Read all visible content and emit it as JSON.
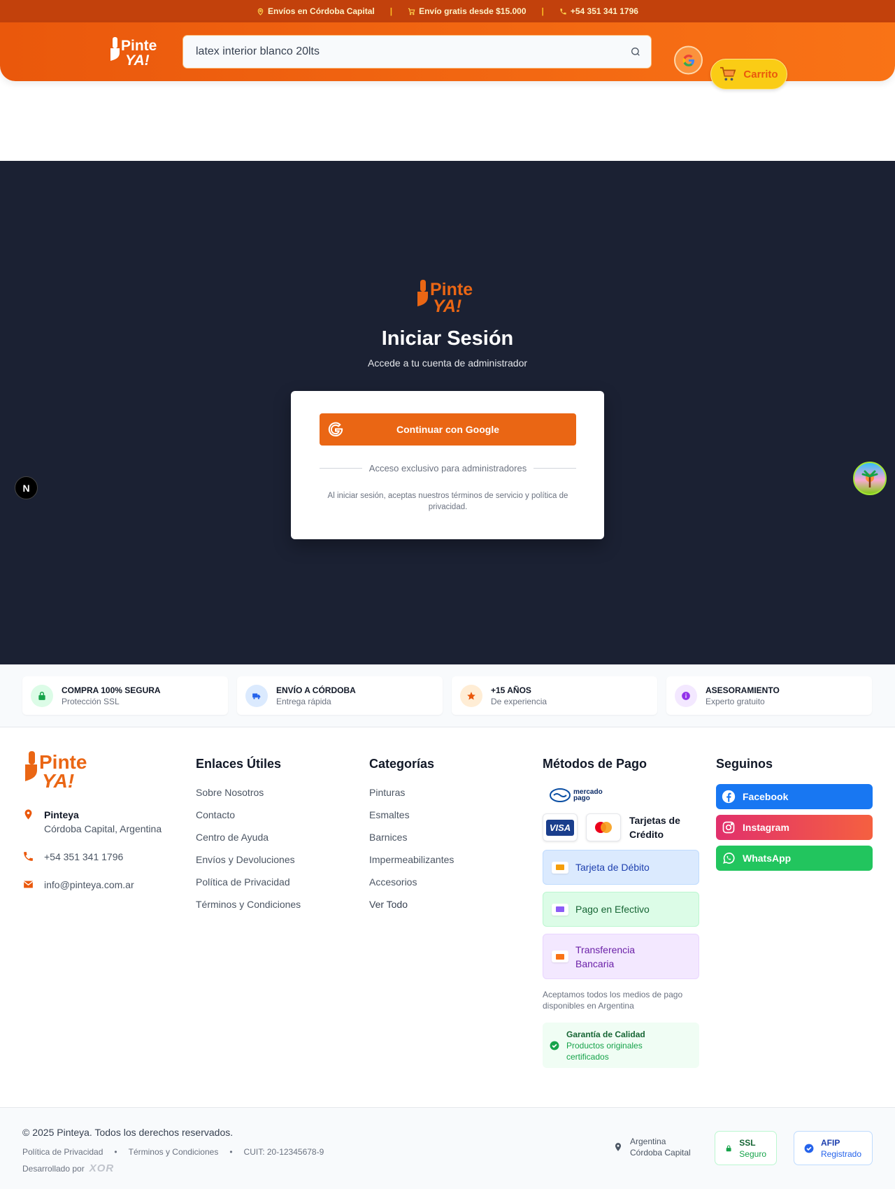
{
  "topbar": {
    "shipping": "Envíos en Córdoba Capital",
    "free_shipping": "Envío gratis desde $15.000",
    "phone": "+54 351 341 1796"
  },
  "brand": {
    "line1": "Pinte",
    "line2": "YA!"
  },
  "search": {
    "value": "latex interior blanco 20lts"
  },
  "header": {
    "cart_label": "Carrito"
  },
  "login": {
    "title": "Iniciar Sesión",
    "subtitle": "Accede a tu cuenta de administrador",
    "google_button": "Continuar con Google",
    "divider_text": "Acceso exclusivo para administradores",
    "legal": "Al iniciar sesión, aceptas nuestros términos de servicio y política de privacidad."
  },
  "dev_badge": "N",
  "features": [
    {
      "title": "COMPRA 100% SEGURA",
      "sub": "Protección SSL",
      "bg": "#dcfce7",
      "color": "#16a34a",
      "icon": "lock-icon"
    },
    {
      "title": "ENVÍO A CÓRDOBA",
      "sub": "Entrega rápida",
      "bg": "#dbeafe",
      "color": "#2563eb",
      "icon": "truck-icon"
    },
    {
      "title": "+15 AÑOS",
      "sub": "De experiencia",
      "bg": "#ffedd5",
      "color": "#ea580c",
      "icon": "star-icon"
    },
    {
      "title": "ASESORAMIENTO",
      "sub": "Experto gratuito",
      "bg": "#f3e8ff",
      "color": "#9333ea",
      "icon": "info-icon"
    }
  ],
  "footer": {
    "company": "Pinteya",
    "address": "Córdoba Capital, Argentina",
    "phone": "+54 351 341 1796",
    "email": "info@pinteya.com.ar",
    "links_title": "Enlaces Útiles",
    "links": [
      "Sobre Nosotros",
      "Contacto",
      "Centro de Ayuda",
      "Envíos y Devoluciones",
      "Política de Privacidad",
      "Términos y Condiciones"
    ],
    "categories_title": "Categorías",
    "categories": [
      "Pinturas",
      "Esmaltes",
      "Barnices",
      "Impermeabilizantes",
      "Accesorios",
      "Ver Todo"
    ],
    "payment_title": "Métodos de Pago",
    "mercadopago": "mercado pago",
    "visa": "VISA",
    "credit_cards": "Tarjetas de Crédito",
    "debit": "Tarjeta de Débito",
    "cash": "Pago en Efectivo",
    "transfer": "Transferencia Bancaria",
    "payment_note": "Aceptamos todos los medios de pago disponibles en Argentina",
    "guarantee_title": "Garantía de Calidad",
    "guarantee_sub": "Productos originales certificados",
    "social_title": "Seguinos",
    "social": [
      "Facebook",
      "Instagram",
      "WhatsApp"
    ]
  },
  "bottom": {
    "copyright": "© 2025 Pinteya. Todos los derechos reservados.",
    "privacy": "Política de Privacidad",
    "terms": "Términos y Condiciones",
    "cuit": "CUIT: 20-12345678-9",
    "dev_by": "Desarrollado por",
    "dev_logo": "XOR",
    "country": "Argentina",
    "city": "Córdoba Capital",
    "ssl_title": "SSL",
    "ssl_sub": "Seguro",
    "afip_title": "AFIP",
    "afip_sub": "Registrado"
  },
  "colors": {
    "brand_orange": "#ea580c",
    "topbar": "#c2410c",
    "login_bg": "#1b2133",
    "cart_yellow": "#facc15"
  }
}
